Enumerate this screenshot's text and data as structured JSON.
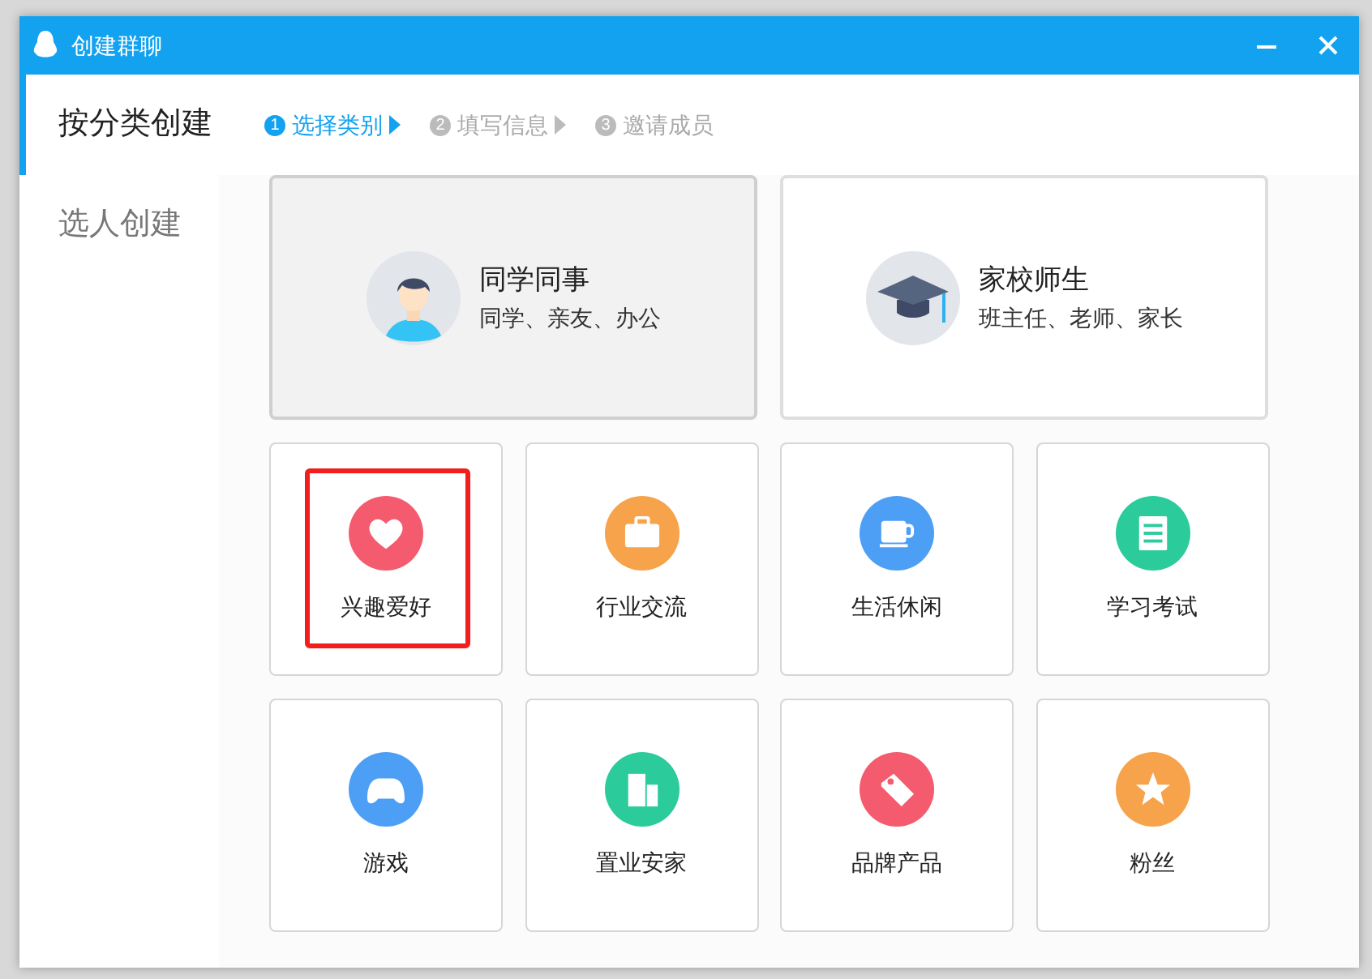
{
  "window": {
    "title": "创建群聊"
  },
  "sidebar": {
    "items": [
      {
        "label": "按分类创建",
        "selected": true
      },
      {
        "label": "选人创建",
        "selected": false
      }
    ]
  },
  "steps": [
    {
      "number": "1",
      "label": "选择类别",
      "selected": true
    },
    {
      "number": "2",
      "label": "填写信息",
      "selected": false
    },
    {
      "number": "3",
      "label": "邀请成员",
      "selected": false
    }
  ],
  "main_categories": [
    {
      "kind": "person",
      "title": "同学同事",
      "subtitle": "同学、亲友、办公",
      "selected": true
    },
    {
      "kind": "graduation",
      "title": "家校师生",
      "subtitle": "班主任、老师、家长",
      "selected": false
    }
  ],
  "categories": [
    {
      "kind": "heart",
      "label": "兴趣爱好",
      "color": "#f45b6e",
      "highlighted": true
    },
    {
      "kind": "briefcase",
      "label": "行业交流",
      "color": "#f7a34b",
      "highlighted": false
    },
    {
      "kind": "cup",
      "label": "生活休闲",
      "color": "#4d9ff5",
      "highlighted": false
    },
    {
      "kind": "notebook",
      "label": "学习考试",
      "color": "#2ccb9c",
      "highlighted": false
    },
    {
      "kind": "gamepad",
      "label": "游戏",
      "color": "#4d9ff5",
      "highlighted": false
    },
    {
      "kind": "building",
      "label": "置业安家",
      "color": "#2ccb9c",
      "highlighted": false
    },
    {
      "kind": "tag",
      "label": "品牌产品",
      "color": "#f45b6e",
      "highlighted": false
    },
    {
      "kind": "star",
      "label": "粉丝",
      "color": "#f7a34b",
      "highlighted": false
    }
  ]
}
